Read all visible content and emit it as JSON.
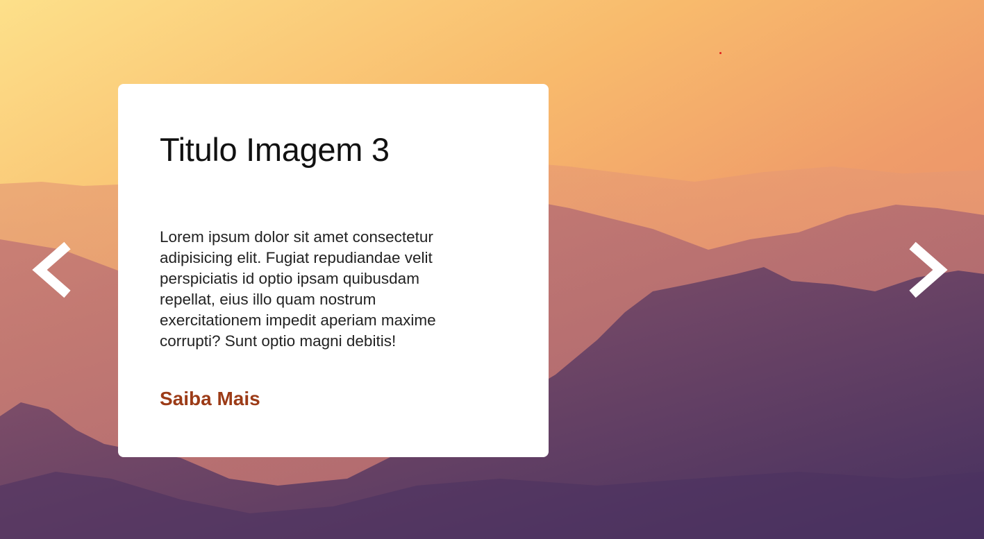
{
  "slide": {
    "title": "Titulo Imagem 3",
    "description": "Lorem ipsum dolor sit amet consectetur adipisicing elit. Fugiat repudiandae velit perspiciatis id optio ipsam quibusdam repellat, eius illo quam nostrum exercitationem impedit aperiam maxime corrupti? Sunt optio magni debitis!",
    "cta_label": "Saiba Mais"
  },
  "controls": {
    "prev_icon": "chevron-left-icon",
    "next_icon": "chevron-right-icon"
  },
  "colors": {
    "cta": "#9c3b17",
    "card_background": "#ffffff",
    "arrow": "#ffffff",
    "marker_dot": "#e0201b"
  }
}
